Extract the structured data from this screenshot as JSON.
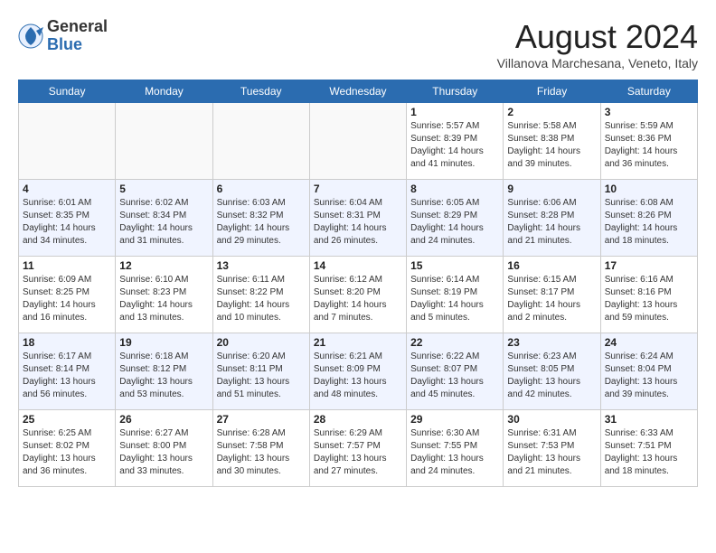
{
  "header": {
    "logo_general": "General",
    "logo_blue": "Blue",
    "month_title": "August 2024",
    "location": "Villanova Marchesana, Veneto, Italy"
  },
  "days_of_week": [
    "Sunday",
    "Monday",
    "Tuesday",
    "Wednesday",
    "Thursday",
    "Friday",
    "Saturday"
  ],
  "weeks": [
    [
      {
        "day": "",
        "info": ""
      },
      {
        "day": "",
        "info": ""
      },
      {
        "day": "",
        "info": ""
      },
      {
        "day": "",
        "info": ""
      },
      {
        "day": "1",
        "info": "Sunrise: 5:57 AM\nSunset: 8:39 PM\nDaylight: 14 hours\nand 41 minutes."
      },
      {
        "day": "2",
        "info": "Sunrise: 5:58 AM\nSunset: 8:38 PM\nDaylight: 14 hours\nand 39 minutes."
      },
      {
        "day": "3",
        "info": "Sunrise: 5:59 AM\nSunset: 8:36 PM\nDaylight: 14 hours\nand 36 minutes."
      }
    ],
    [
      {
        "day": "4",
        "info": "Sunrise: 6:01 AM\nSunset: 8:35 PM\nDaylight: 14 hours\nand 34 minutes."
      },
      {
        "day": "5",
        "info": "Sunrise: 6:02 AM\nSunset: 8:34 PM\nDaylight: 14 hours\nand 31 minutes."
      },
      {
        "day": "6",
        "info": "Sunrise: 6:03 AM\nSunset: 8:32 PM\nDaylight: 14 hours\nand 29 minutes."
      },
      {
        "day": "7",
        "info": "Sunrise: 6:04 AM\nSunset: 8:31 PM\nDaylight: 14 hours\nand 26 minutes."
      },
      {
        "day": "8",
        "info": "Sunrise: 6:05 AM\nSunset: 8:29 PM\nDaylight: 14 hours\nand 24 minutes."
      },
      {
        "day": "9",
        "info": "Sunrise: 6:06 AM\nSunset: 8:28 PM\nDaylight: 14 hours\nand 21 minutes."
      },
      {
        "day": "10",
        "info": "Sunrise: 6:08 AM\nSunset: 8:26 PM\nDaylight: 14 hours\nand 18 minutes."
      }
    ],
    [
      {
        "day": "11",
        "info": "Sunrise: 6:09 AM\nSunset: 8:25 PM\nDaylight: 14 hours\nand 16 minutes."
      },
      {
        "day": "12",
        "info": "Sunrise: 6:10 AM\nSunset: 8:23 PM\nDaylight: 14 hours\nand 13 minutes."
      },
      {
        "day": "13",
        "info": "Sunrise: 6:11 AM\nSunset: 8:22 PM\nDaylight: 14 hours\nand 10 minutes."
      },
      {
        "day": "14",
        "info": "Sunrise: 6:12 AM\nSunset: 8:20 PM\nDaylight: 14 hours\nand 7 minutes."
      },
      {
        "day": "15",
        "info": "Sunrise: 6:14 AM\nSunset: 8:19 PM\nDaylight: 14 hours\nand 5 minutes."
      },
      {
        "day": "16",
        "info": "Sunrise: 6:15 AM\nSunset: 8:17 PM\nDaylight: 14 hours\nand 2 minutes."
      },
      {
        "day": "17",
        "info": "Sunrise: 6:16 AM\nSunset: 8:16 PM\nDaylight: 13 hours\nand 59 minutes."
      }
    ],
    [
      {
        "day": "18",
        "info": "Sunrise: 6:17 AM\nSunset: 8:14 PM\nDaylight: 13 hours\nand 56 minutes."
      },
      {
        "day": "19",
        "info": "Sunrise: 6:18 AM\nSunset: 8:12 PM\nDaylight: 13 hours\nand 53 minutes."
      },
      {
        "day": "20",
        "info": "Sunrise: 6:20 AM\nSunset: 8:11 PM\nDaylight: 13 hours\nand 51 minutes."
      },
      {
        "day": "21",
        "info": "Sunrise: 6:21 AM\nSunset: 8:09 PM\nDaylight: 13 hours\nand 48 minutes."
      },
      {
        "day": "22",
        "info": "Sunrise: 6:22 AM\nSunset: 8:07 PM\nDaylight: 13 hours\nand 45 minutes."
      },
      {
        "day": "23",
        "info": "Sunrise: 6:23 AM\nSunset: 8:05 PM\nDaylight: 13 hours\nand 42 minutes."
      },
      {
        "day": "24",
        "info": "Sunrise: 6:24 AM\nSunset: 8:04 PM\nDaylight: 13 hours\nand 39 minutes."
      }
    ],
    [
      {
        "day": "25",
        "info": "Sunrise: 6:25 AM\nSunset: 8:02 PM\nDaylight: 13 hours\nand 36 minutes."
      },
      {
        "day": "26",
        "info": "Sunrise: 6:27 AM\nSunset: 8:00 PM\nDaylight: 13 hours\nand 33 minutes."
      },
      {
        "day": "27",
        "info": "Sunrise: 6:28 AM\nSunset: 7:58 PM\nDaylight: 13 hours\nand 30 minutes."
      },
      {
        "day": "28",
        "info": "Sunrise: 6:29 AM\nSunset: 7:57 PM\nDaylight: 13 hours\nand 27 minutes."
      },
      {
        "day": "29",
        "info": "Sunrise: 6:30 AM\nSunset: 7:55 PM\nDaylight: 13 hours\nand 24 minutes."
      },
      {
        "day": "30",
        "info": "Sunrise: 6:31 AM\nSunset: 7:53 PM\nDaylight: 13 hours\nand 21 minutes."
      },
      {
        "day": "31",
        "info": "Sunrise: 6:33 AM\nSunset: 7:51 PM\nDaylight: 13 hours\nand 18 minutes."
      }
    ]
  ]
}
